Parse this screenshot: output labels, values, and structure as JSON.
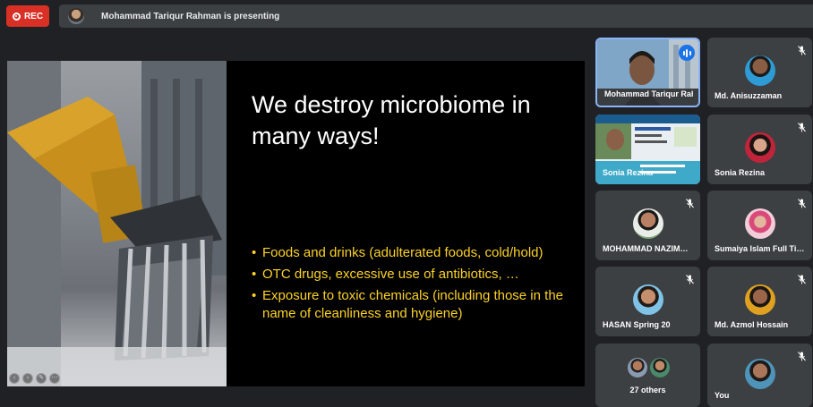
{
  "recording": {
    "label": "REC"
  },
  "presenting_banner": {
    "text": "Mohammad Tariqur Rahman is presenting"
  },
  "slide": {
    "title": "We destroy microbiome in many ways!",
    "bullets": [
      "Foods and drinks (adulterated foods, cold/hold)",
      "OTC drugs, excessive use of antibiotics, …",
      "Exposure to toxic chemicals (including those in the name of cleanliness and hygiene)"
    ]
  },
  "participants": {
    "tiles": [
      {
        "name": "Mohammad Tariqur Rahman",
        "speaking": true
      },
      {
        "name": "Md. Anisuzzaman",
        "muted": true
      },
      {
        "name": "Sonia Rezina"
      },
      {
        "name": "Sonia Rezina",
        "muted": true
      },
      {
        "name": "MOHAMMAD NAZIM…",
        "muted": true
      },
      {
        "name": "Sumaiya Islam Full Ti…",
        "muted": true
      },
      {
        "name": "HASAN Spring 20",
        "muted": true
      },
      {
        "name": "Md. Azmol Hossain",
        "muted": true
      },
      {
        "name": "27 others"
      },
      {
        "name": "You",
        "muted": true
      }
    ]
  },
  "colors": {
    "background": "#202124",
    "tile": "#3c4043",
    "rec": "#d93025",
    "slide_text": "#fcd228",
    "speaking": "#1a73e8"
  },
  "icons": [
    "record-icon",
    "mic-off-icon",
    "speaking-icon",
    "slide-nav-icon"
  ]
}
